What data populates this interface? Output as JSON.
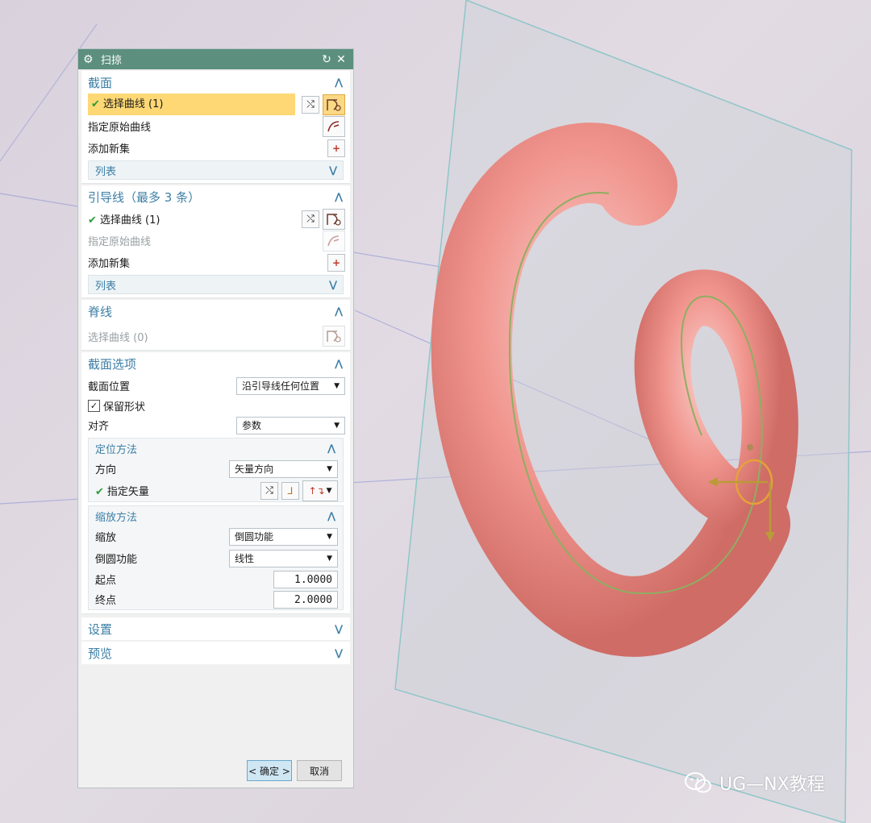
{
  "dialog": {
    "title": "扫掠",
    "section": {
      "title": "截面",
      "select_curve": "选择曲线 (1)",
      "specify_origin": "指定原始曲线",
      "add_set": "添加新集",
      "list": "列表"
    },
    "guide": {
      "title": "引导线（最多 3 条）",
      "select_curve": "选择曲线 (1)",
      "specify_origin": "指定原始曲线",
      "add_set": "添加新集",
      "list": "列表"
    },
    "spine": {
      "title": "脊线",
      "select_curve": "选择曲线 (0)"
    },
    "section_options": {
      "title": "截面选项",
      "position_label": "截面位置",
      "position_value": "沿引导线任何位置",
      "preserve_shape": "保留形状",
      "align_label": "对齐",
      "align_value": "参数",
      "orientation": {
        "title": "定位方法",
        "direction_label": "方向",
        "direction_value": "矢量方向",
        "specify_vector": "指定矢量"
      },
      "scaling": {
        "title": "缩放方法",
        "scale_label": "缩放",
        "scale_value": "倒圆功能",
        "blend_label": "倒圆功能",
        "blend_value": "线性",
        "start_label": "起点",
        "start_value": "1.0000",
        "end_label": "终点",
        "end_value": "2.0000"
      }
    },
    "settings": "设置",
    "preview": "预览",
    "ok": "< 确定 >",
    "cancel": "取消"
  },
  "watermark": "UG—NX教程",
  "colors": {
    "title_bar": "#5c8f7e",
    "group_heading": "#3d7fa6",
    "highlight": "#fdd874",
    "torus": "#f1928c"
  }
}
